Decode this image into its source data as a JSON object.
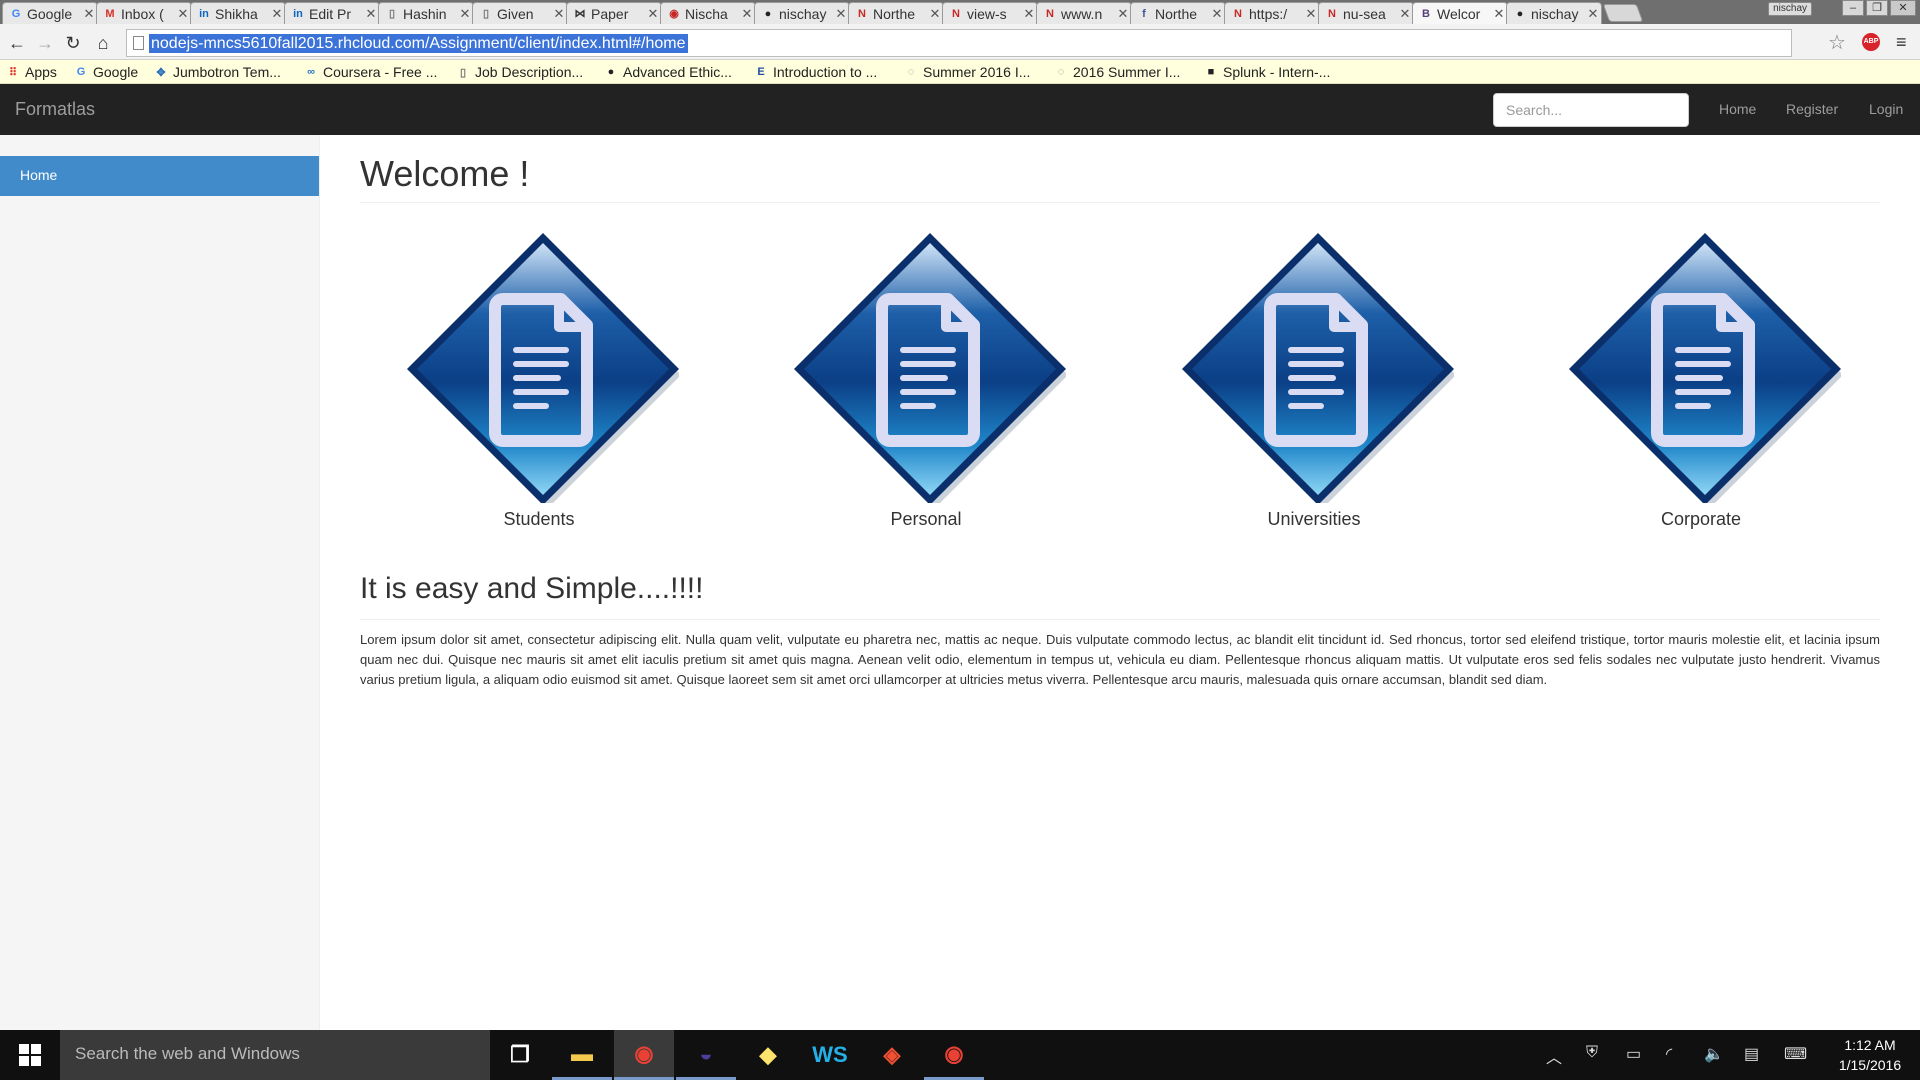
{
  "browser": {
    "tabs": [
      {
        "title": "Google",
        "favicon": "google-icon",
        "color": "#4285f4",
        "glyph": "G",
        "active": false
      },
      {
        "title": "Inbox (",
        "favicon": "gmail-icon",
        "color": "#d93025",
        "glyph": "M",
        "active": false
      },
      {
        "title": "Shikha",
        "favicon": "linkedin-icon",
        "color": "#0a66c2",
        "glyph": "in",
        "active": false
      },
      {
        "title": "Edit Pr",
        "favicon": "linkedin-icon",
        "color": "#0a66c2",
        "glyph": "in",
        "active": false
      },
      {
        "title": "Hashin",
        "favicon": "page-icon",
        "color": "#777777",
        "glyph": "▯",
        "active": false
      },
      {
        "title": "Given",
        "favicon": "page-icon",
        "color": "#777777",
        "glyph": "▯",
        "active": false
      },
      {
        "title": "Paper",
        "favicon": "paper-icon",
        "color": "#333333",
        "glyph": "⋈",
        "active": false
      },
      {
        "title": "Nischa",
        "favicon": "red-square-icon",
        "color": "#c62828",
        "glyph": "◉",
        "active": false
      },
      {
        "title": "nischay",
        "favicon": "github-icon",
        "color": "#222222",
        "glyph": "●",
        "active": false
      },
      {
        "title": "Northe",
        "favicon": "neu-icon",
        "color": "#c62828",
        "glyph": "N",
        "active": false
      },
      {
        "title": "view-s",
        "favicon": "neu-icon",
        "color": "#c62828",
        "glyph": "N",
        "active": false
      },
      {
        "title": "www.n",
        "favicon": "neu-icon",
        "color": "#c62828",
        "glyph": "N",
        "active": false
      },
      {
        "title": "Northe",
        "favicon": "facebook-icon",
        "color": "#3b5998",
        "glyph": "f",
        "active": false
      },
      {
        "title": "https:/",
        "favicon": "neu-icon",
        "color": "#c62828",
        "glyph": "N",
        "active": false
      },
      {
        "title": "nu-sea",
        "favicon": "neu-icon",
        "color": "#c62828",
        "glyph": "N",
        "active": false
      },
      {
        "title": "Welcor",
        "favicon": "bootstrap-icon",
        "color": "#563d7c",
        "glyph": "B",
        "active": true
      },
      {
        "title": "nischay",
        "favicon": "github-icon",
        "color": "#222222",
        "glyph": "●",
        "active": false
      }
    ],
    "user_badge": "nischay",
    "url": "nodejs-mncs5610fall2015.rhcloud.com/Assignment/client/index.html#/home",
    "bookmarks": [
      {
        "label": "Apps",
        "icon": "apps-grid-icon",
        "glyph": "⠿",
        "color": "#d93025"
      },
      {
        "label": "Google",
        "icon": "google-icon",
        "glyph": "G",
        "color": "#4285f4"
      },
      {
        "label": "Jumbotron Tem...",
        "icon": "bootstrap-icon",
        "glyph": "✥",
        "color": "#2a6ebb"
      },
      {
        "label": "Coursera - Free ...",
        "icon": "coursera-icon",
        "glyph": "∞",
        "color": "#2a73cc"
      },
      {
        "label": "Job Description...",
        "icon": "page-icon",
        "glyph": "▯",
        "color": "#777777"
      },
      {
        "label": "Advanced Ethic...",
        "icon": "github-icon",
        "glyph": "●",
        "color": "#222222"
      },
      {
        "label": "Introduction to ...",
        "icon": "e-book-icon",
        "glyph": "E",
        "color": "#1f4e9c"
      },
      {
        "label": "Summer 2016 I...",
        "icon": "chat-bubble-icon",
        "glyph": "◌",
        "color": "#888888"
      },
      {
        "label": "2016 Summer I...",
        "icon": "chat-bubble-icon",
        "glyph": "◌",
        "color": "#888888"
      },
      {
        "label": "Splunk - Intern-...",
        "icon": "splunk-icon",
        "glyph": "■",
        "color": "#222222"
      }
    ]
  },
  "app": {
    "brand": "Formatlas",
    "search_placeholder": "Search...",
    "nav": {
      "home": "Home",
      "register": "Register",
      "login": "Login"
    },
    "sidebar": {
      "items": [
        {
          "label": "Home",
          "active": true
        }
      ]
    },
    "main": {
      "title": "Welcome !",
      "tiles": [
        {
          "label": "Students",
          "icon": "document-diamond-icon"
        },
        {
          "label": "Personal",
          "icon": "document-diamond-icon"
        },
        {
          "label": "Universities",
          "icon": "document-diamond-icon"
        },
        {
          "label": "Corporate",
          "icon": "document-diamond-icon"
        }
      ],
      "subtitle": "It is easy and Simple....!!!!",
      "body": "Lorem ipsum dolor sit amet, consectetur adipiscing elit. Nulla quam velit, vulputate eu pharetra nec, mattis ac neque. Duis vulputate commodo lectus, ac blandit elit tincidunt id. Sed rhoncus, tortor sed eleifend tristique, tortor mauris molestie elit, et lacinia ipsum quam nec dui. Quisque nec mauris sit amet elit iaculis pretium sit amet quis magna. Aenean velit odio, elementum in tempus ut, vehicula eu diam. Pellentesque rhoncus aliquam mattis. Ut vulputate eros sed felis sodales nec vulputate justo hendrerit. Vivamus varius pretium ligula, a aliquam odio euismod sit amet. Quisque laoreet sem sit amet orci ullamcorper at ultricies metus viverra. Pellentesque arcu mauris, malesuada quis ornare accumsan, blandit sed diam."
    }
  },
  "taskbar": {
    "search_placeholder": "Search the web and Windows",
    "apps": [
      {
        "name": "task-view-icon",
        "glyph": "❐",
        "color": "#ffffff",
        "state": "none"
      },
      {
        "name": "file-explorer-icon",
        "glyph": "▬",
        "color": "#f2c94c",
        "state": "open"
      },
      {
        "name": "chrome-icon",
        "glyph": "◉",
        "color": "#e94235",
        "state": "active"
      },
      {
        "name": "eclipse-icon",
        "glyph": "◒",
        "color": "#4b3f9b",
        "state": "open"
      },
      {
        "name": "sticky-notes-icon",
        "glyph": "◆",
        "color": "#fce36b",
        "state": "none"
      },
      {
        "name": "webstorm-icon",
        "glyph": "WS",
        "color": "#25b0e8",
        "state": "none"
      },
      {
        "name": "git-icon",
        "glyph": "◈",
        "color": "#f05033",
        "state": "none"
      },
      {
        "name": "chrome-icon",
        "glyph": "◉",
        "color": "#e94235",
        "state": "open"
      }
    ],
    "tray": [
      {
        "name": "show-hidden-icons-icon",
        "glyph": "︿"
      },
      {
        "name": "mcafee-icon",
        "glyph": "⛨"
      },
      {
        "name": "battery-icon",
        "glyph": "▭"
      },
      {
        "name": "wifi-icon",
        "glyph": "◜"
      },
      {
        "name": "volume-icon",
        "glyph": "🔈"
      },
      {
        "name": "notifications-icon",
        "glyph": "▤"
      },
      {
        "name": "keyboard-icon",
        "glyph": "⌨"
      }
    ],
    "time": "1:12 AM",
    "date": "1/15/2016"
  }
}
